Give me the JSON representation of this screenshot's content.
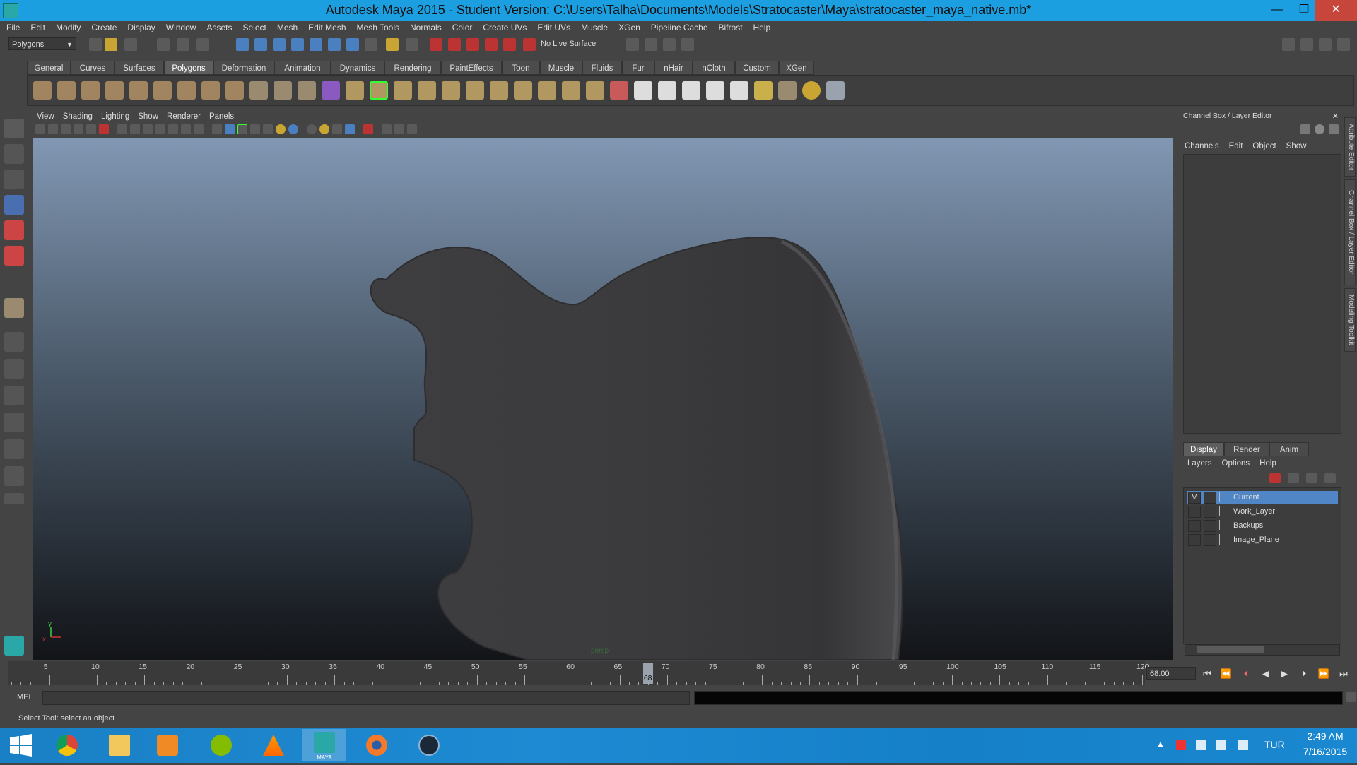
{
  "window": {
    "title": "Autodesk Maya 2015 - Student Version: C:\\Users\\Talha\\Documents\\Models\\Stratocaster\\Maya\\stratocaster_maya_native.mb*",
    "minimize": "—",
    "maximize": "❐",
    "close": "✕"
  },
  "menubar": [
    "File",
    "Edit",
    "Modify",
    "Create",
    "Display",
    "Window",
    "Assets",
    "Select",
    "Mesh",
    "Edit Mesh",
    "Mesh Tools",
    "Normals",
    "Color",
    "Create UVs",
    "Edit UVs",
    "Muscle",
    "XGen",
    "Pipeline Cache",
    "Bifrost",
    "Help"
  ],
  "statusline": {
    "mode": "Polygons",
    "live_surface": "No Live Surface"
  },
  "shelf_tabs": [
    "General",
    "Curves",
    "Surfaces",
    "Polygons",
    "Deformation",
    "Animation",
    "Dynamics",
    "Rendering",
    "PaintEffects",
    "Toon",
    "Muscle",
    "Fluids",
    "Fur",
    "nHair",
    "nCloth",
    "Custom",
    "XGen"
  ],
  "active_shelf_tab": "Polygons",
  "viewport": {
    "menu": [
      "View",
      "Shading",
      "Lighting",
      "Show",
      "Renderer",
      "Panels"
    ],
    "camera_label": "persp",
    "axis_x": "x",
    "axis_y": "y"
  },
  "channel_box": {
    "title": "Channel Box / Layer Editor",
    "menu": [
      "Channels",
      "Edit",
      "Object",
      "Show"
    ]
  },
  "layer_editor": {
    "tabs": [
      "Display",
      "Render",
      "Anim"
    ],
    "active_tab": "Display",
    "menu": [
      "Layers",
      "Options",
      "Help"
    ],
    "layers": [
      {
        "name": "Current",
        "visible": "V",
        "selected": true
      },
      {
        "name": "Work_Layer",
        "visible": "",
        "selected": false
      },
      {
        "name": "Backups",
        "visible": "",
        "selected": false
      },
      {
        "name": "Image_Plane",
        "visible": "",
        "selected": false
      }
    ]
  },
  "side_tabs": [
    "Attribute Editor",
    "Channel Box / Layer Editor",
    "Modeling Toolkit"
  ],
  "timeline": {
    "start": 1,
    "end": 120,
    "labels": [
      "5",
      "10",
      "15",
      "20",
      "25",
      "30",
      "35",
      "40",
      "45",
      "50",
      "55",
      "60",
      "65",
      "70",
      "75",
      "80",
      "85",
      "90",
      "95",
      "100",
      "105",
      "110",
      "115",
      "120"
    ],
    "current_frame": "68",
    "current_frame_field": "68.00"
  },
  "command_line": {
    "label": "MEL"
  },
  "help_line": {
    "text": "Select Tool: select an object"
  },
  "taskbar": {
    "apps": [
      "chrome-icon",
      "file-explorer-icon",
      "media-player-icon",
      "spotify-icon",
      "vlc-icon",
      "maya-icon",
      "blender-icon",
      "steam-icon"
    ],
    "active_app": "maya-icon",
    "maya_label": "MAYA",
    "language": "TUR",
    "time": "2:49 AM",
    "date": "7/16/2015"
  },
  "colors": {
    "titlebar": "#1b9fe0",
    "ui_bg": "#444444",
    "layer_selected": "#5186c6",
    "viewport_top": "#8197b3",
    "viewport_bottom": "#121418",
    "taskbar": "#1d8ad3"
  }
}
